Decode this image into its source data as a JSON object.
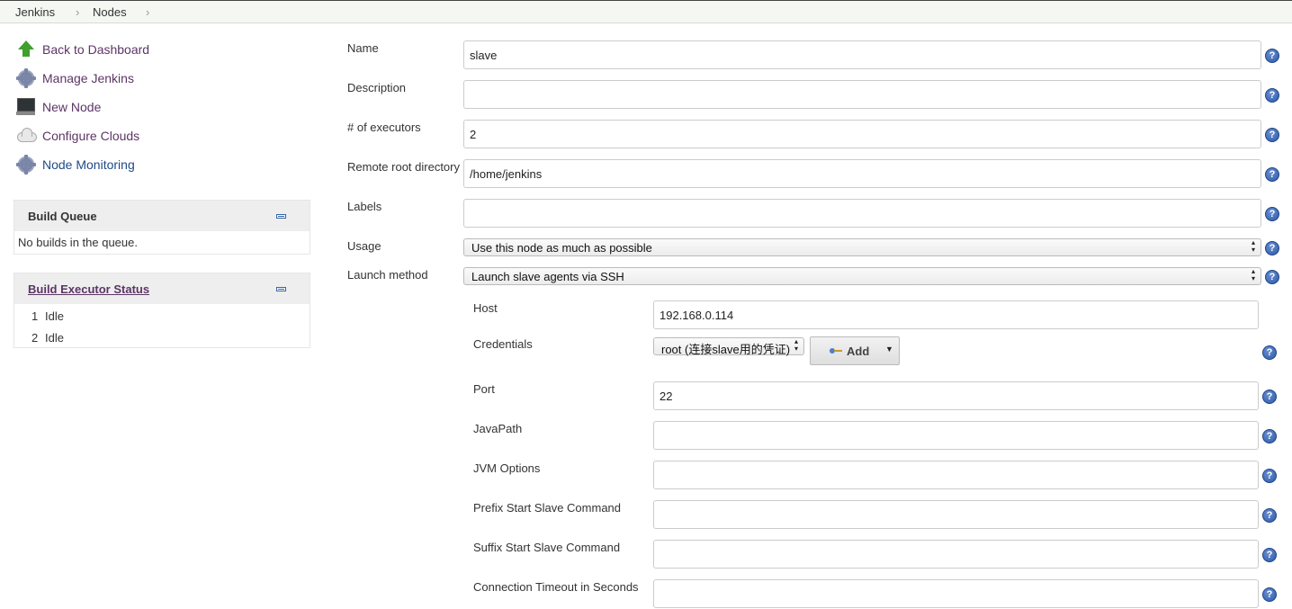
{
  "breadcrumb": {
    "items": [
      "Jenkins",
      "Nodes"
    ]
  },
  "sidebar": {
    "tasks": [
      {
        "label": "Back to Dashboard",
        "icon": "up-arrow-icon"
      },
      {
        "label": "Manage Jenkins",
        "icon": "gear-icon"
      },
      {
        "label": "New Node",
        "icon": "computer-icon"
      },
      {
        "label": "Configure Clouds",
        "icon": "cloud-icon"
      },
      {
        "label": "Node Monitoring",
        "icon": "gear-icon"
      }
    ],
    "build_queue": {
      "title": "Build Queue",
      "empty_text": "No builds in the queue."
    },
    "executor_status": {
      "title": "Build Executor Status",
      "executors": [
        {
          "num": "1",
          "state": "Idle"
        },
        {
          "num": "2",
          "state": "Idle"
        }
      ]
    }
  },
  "form": {
    "name": {
      "label": "Name",
      "value": "slave"
    },
    "description": {
      "label": "Description",
      "value": ""
    },
    "executors": {
      "label": "# of executors",
      "value": "2"
    },
    "remote_root": {
      "label": "Remote root directory",
      "value": "/home/jenkins"
    },
    "labels": {
      "label": "Labels",
      "value": ""
    },
    "usage": {
      "label": "Usage",
      "value": "Use this node as much as possible"
    },
    "launch_method": {
      "label": "Launch method",
      "value": "Launch slave agents via SSH"
    },
    "ssh": {
      "host": {
        "label": "Host",
        "value": "192.168.0.114"
      },
      "credentials": {
        "label": "Credentials",
        "value": "root (连接slave用的凭证)",
        "add_label": "Add"
      },
      "port": {
        "label": "Port",
        "value": "22"
      },
      "java_path": {
        "label": "JavaPath",
        "value": ""
      },
      "jvm_options": {
        "label": "JVM Options",
        "value": ""
      },
      "prefix_cmd": {
        "label": "Prefix Start Slave Command",
        "value": ""
      },
      "suffix_cmd": {
        "label": "Suffix Start Slave Command",
        "value": ""
      },
      "timeout": {
        "label": "Connection Timeout in Seconds",
        "value": ""
      }
    }
  },
  "colors": {
    "link_purple": "#5c3566",
    "link_blue": "#204a87",
    "help_blue": "#2b5aa8",
    "pane_header": "#eeeeee"
  }
}
